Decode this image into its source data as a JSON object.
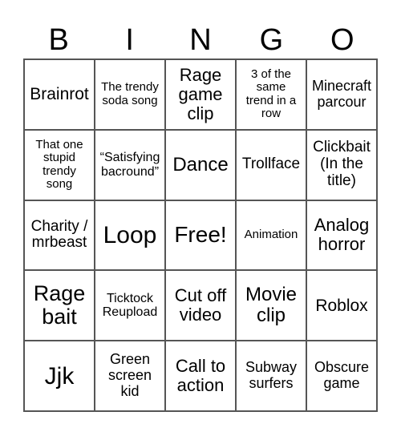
{
  "header": [
    "B",
    "I",
    "N",
    "G",
    "O"
  ],
  "cells": [
    "Brainrot",
    "The trendy soda song",
    "Rage game clip",
    "3 of the same trend in a row",
    "Minecraft parcour",
    "That one stupid trendy song",
    "“Satisfying bacround”",
    "Dance",
    "Trollface",
    "Clickbait (In the title)",
    "Charity / mrbeast",
    "Loop",
    "Free!",
    "Animation",
    "Analog horror",
    "Rage bait",
    "Ticktock Reupload",
    "Cut off video",
    "Movie clip",
    "Roblox",
    "Jjk",
    "Green screen kid",
    "Call to action",
    "Subway surfers",
    "Obscure game"
  ]
}
